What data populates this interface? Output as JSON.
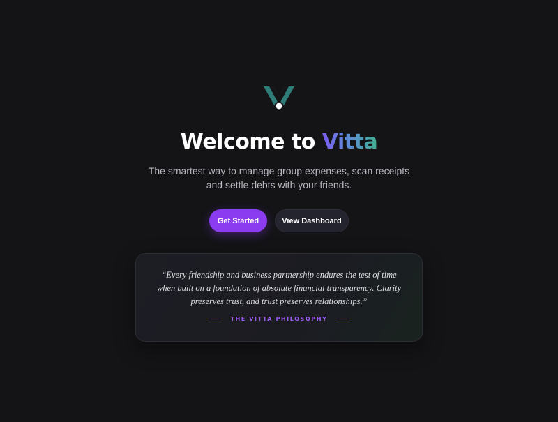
{
  "hero": {
    "title_prefix": "Welcome to ",
    "title_brand": "Vitta",
    "subtitle": "The smartest way to manage group expenses, scan receipts and settle debts with your friends."
  },
  "actions": {
    "primary_label": "Get Started",
    "secondary_label": "View Dashboard"
  },
  "quote": {
    "text": "“Every friendship and business partnership endures the test of time when built on a foundation of absolute financial transparency. Clarity preserves trust, and trust preserves relationships.”",
    "attribution": "THE VITTA PHILOSOPHY"
  },
  "colors": {
    "background": "#141417",
    "accent": "#8b3cf0",
    "brand_teal": "#2f7d78",
    "attribution": "#9b5cf6"
  },
  "icons": {
    "logo": "vitta-logo-icon"
  }
}
